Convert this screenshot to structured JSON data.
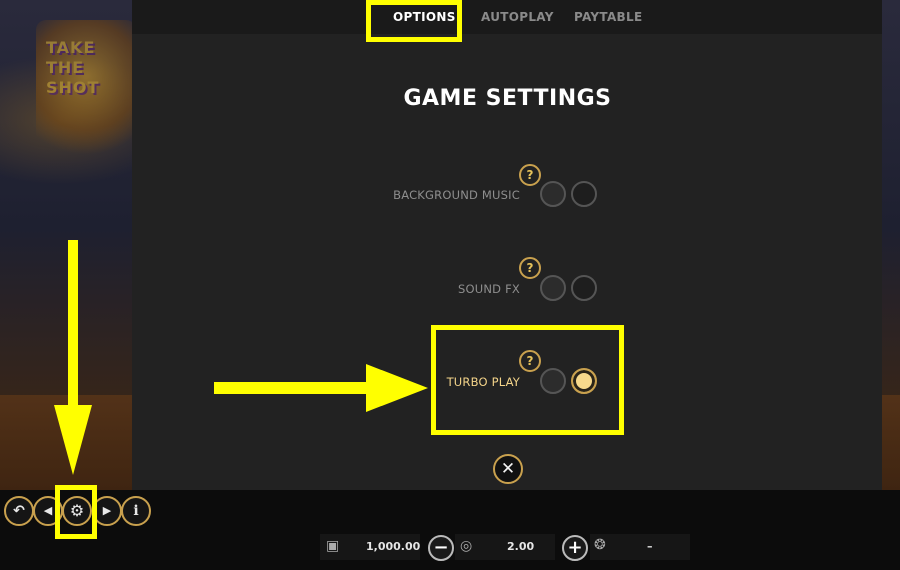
{
  "tabs": {
    "options": "OPTIONS",
    "autoplay": "AUTOPLAY",
    "paytable": "PAYTABLE"
  },
  "settings": {
    "title": "GAME SETTINGS",
    "rows": [
      {
        "label": "BACKGROUND MUSIC",
        "help": "?",
        "on": false
      },
      {
        "label": "SOUND FX",
        "help": "?",
        "on": false
      },
      {
        "label": "TURBO PLAY",
        "help": "?",
        "on": true
      }
    ]
  },
  "close": {
    "glyph": "✕"
  },
  "bottom": {
    "balance": "1,000.00",
    "bet": "2.00",
    "win": "–",
    "minus_glyph": "−",
    "plus_glyph": "+"
  },
  "controls": {
    "back_glyph": "↶",
    "prev_glyph": "◀",
    "settings_glyph": "⚙",
    "next_glyph": "▶",
    "info_glyph": "i"
  },
  "logo_text": "TAKE THE SHOT",
  "colors": {
    "accent": "#c9a14e",
    "highlight": "#ffff00",
    "panel": "#222222",
    "selected_radio": "#f7d98c"
  }
}
